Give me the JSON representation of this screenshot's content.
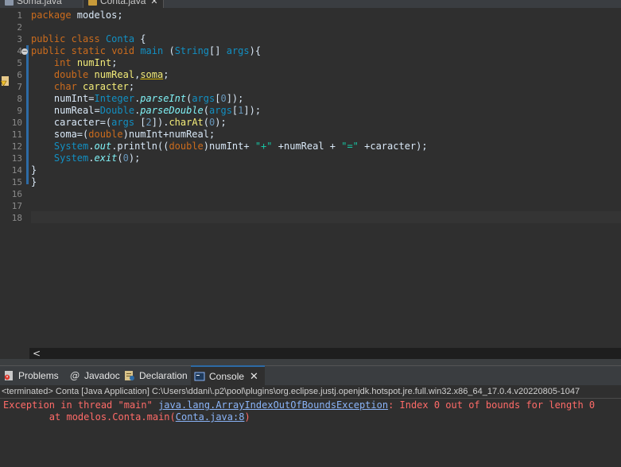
{
  "editor_tabs": [
    {
      "label": "Soma.java",
      "active": false
    },
    {
      "label": "Conta.java",
      "active": true
    }
  ],
  "line_numbers": [
    "1",
    "2",
    "3",
    "4",
    "5",
    "6",
    "7",
    "8",
    "9",
    "10",
    "11",
    "12",
    "13",
    "14",
    "15",
    "16",
    "17",
    "18"
  ],
  "code": {
    "l1": {
      "a": "package",
      "b": " modelos;"
    },
    "l3": {
      "a": "public",
      "b": " ",
      "c": "class",
      "d": " ",
      "e": "Conta",
      "f": " {"
    },
    "l4": {
      "a": "public",
      "b": " ",
      "c": "static",
      "d": " ",
      "e": "void",
      "f": " ",
      "g": "main",
      "h": " (",
      "i": "String",
      "j": "[] ",
      "k": "args",
      "l": "){"
    },
    "l5": {
      "a": "    ",
      "b": "int",
      "c": " ",
      "d": "numInt",
      "e": ";"
    },
    "l6": {
      "a": "    ",
      "b": "double",
      "c": " ",
      "d": "numReal",
      "e": ",",
      "f": "soma",
      "g": ";"
    },
    "l7": {
      "a": "    ",
      "b": "char",
      "c": " ",
      "d": "caracter",
      "e": ";"
    },
    "l8": {
      "a": "    numInt=",
      "b": "Integer",
      "c": ".",
      "d": "parseInt",
      "e": "(",
      "f": "args",
      "g": "[",
      "h": "0",
      "i": "]);"
    },
    "l9": {
      "a": "    numReal=",
      "b": "Double",
      "c": ".",
      "d": "parseDouble",
      "e": "(",
      "f": "args",
      "g": "[",
      "h": "1",
      "i": "]);"
    },
    "l10": {
      "a": "    caracter=(",
      "b": "args",
      "c": " [",
      "d": "2",
      "e": "]).",
      "f": "charAt",
      "g": "(",
      "h": "0",
      "i": ");"
    },
    "l11": {
      "a": "    soma=(",
      "b": "double",
      "c": ")numInt+numReal;"
    },
    "l12": {
      "a": "    ",
      "b": "System",
      "c": ".",
      "d": "out",
      "e": ".println((",
      "f": "double",
      "g": ")numInt+ ",
      "h": "\"+\"",
      "i": " +numReal + ",
      "j": "\"=\"",
      "k": " +caracter);"
    },
    "l13": {
      "a": "    ",
      "b": "System",
      "c": ".",
      "d": "exit",
      "e": "(",
      "f": "0",
      "g": ");"
    },
    "l14": "}",
    "l15": "}"
  },
  "scroll_left_label": "<",
  "panel_tabs": [
    {
      "label": "Problems",
      "icon": "problems-icon"
    },
    {
      "label": "Javadoc",
      "icon": "javadoc-icon"
    },
    {
      "label": "Declaration",
      "icon": "declaration-icon"
    },
    {
      "label": "Console",
      "icon": "console-icon",
      "active": true
    }
  ],
  "console": {
    "status": "<terminated> Conta [Java Application] C:\\Users\\ddani\\.p2\\pool\\plugins\\org.eclipse.justj.openjdk.hotspot.jre.full.win32.x86_64_17.0.4.v20220805-1047",
    "line1_prefix": "Exception in thread \"main\" ",
    "line1_link": "java.lang.ArrayIndexOutOfBoundsException",
    "line1_suffix": ": Index 0 out of bounds for length 0",
    "line2_prefix": "        at modelos.Conta.main(",
    "line2_link": "Conta.java:8",
    "line2_suffix": ")"
  },
  "colors": {
    "background": "#2f2f2f",
    "keyword": "#cc6c1d",
    "type": "#1290c3",
    "error": "#ff6b68",
    "link": "#8ab4f8",
    "accent": "#2d6ba6"
  }
}
